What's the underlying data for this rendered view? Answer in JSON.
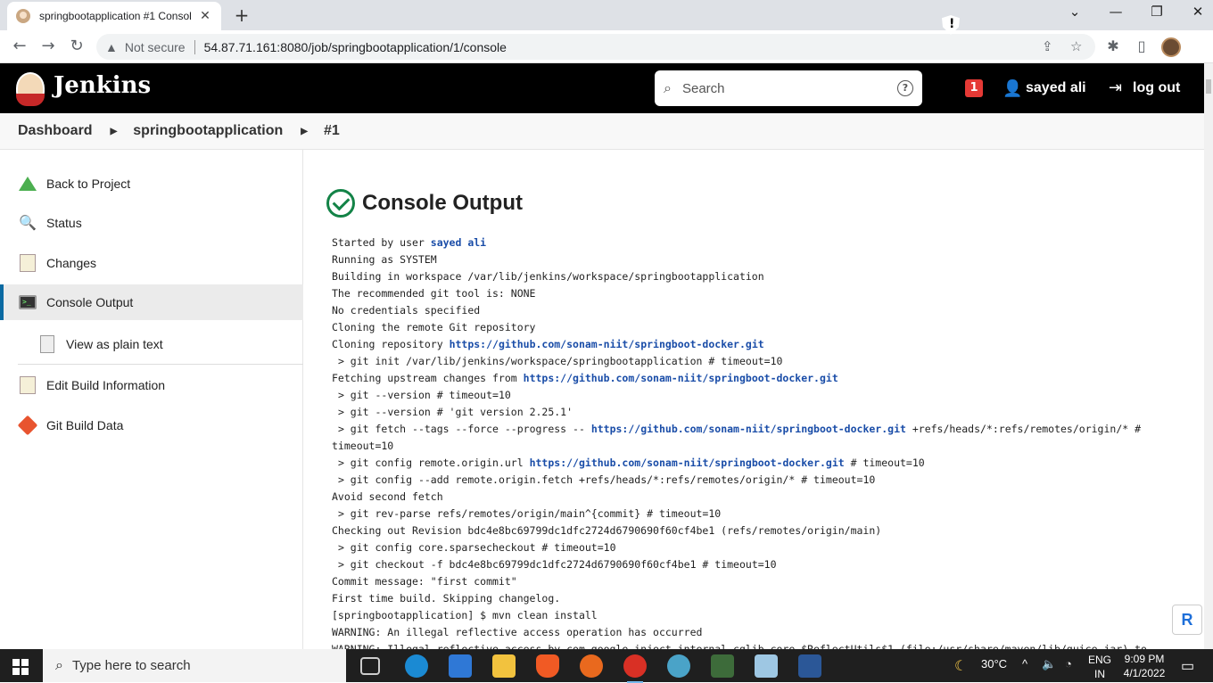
{
  "browser": {
    "tab_title": "springbootapplication #1 Consol",
    "not_secure": "Not secure",
    "url": "54.87.71.161:8080/job/springbootapplication/1/console"
  },
  "header": {
    "app_name": "Jenkins",
    "search_placeholder": "Search",
    "alert_count": "1",
    "user_name": "sayed ali",
    "logout_label": "log out"
  },
  "breadcrumb": {
    "items": [
      "Dashboard",
      "springbootapplication",
      "#1"
    ]
  },
  "sidebar": {
    "items": [
      {
        "label": "Back to Project",
        "icon": "up-arrow-icon"
      },
      {
        "label": "Status",
        "icon": "magnifier-icon"
      },
      {
        "label": "Changes",
        "icon": "notepad-icon"
      },
      {
        "label": "Console Output",
        "icon": "terminal-icon"
      },
      {
        "label": "View as plain text",
        "icon": "document-icon"
      },
      {
        "label": "Edit Build Information",
        "icon": "notepad-icon"
      },
      {
        "label": "Git Build Data",
        "icon": "git-icon"
      }
    ]
  },
  "main": {
    "title": "Console Output",
    "console": [
      {
        "pre": "Started by user ",
        "link": "sayed ali",
        "post": ""
      },
      {
        "pre": "Running as SYSTEM"
      },
      {
        "pre": "Building in workspace /var/lib/jenkins/workspace/springbootapplication"
      },
      {
        "pre": "The recommended git tool is: NONE"
      },
      {
        "pre": "No credentials specified"
      },
      {
        "pre": "Cloning the remote Git repository"
      },
      {
        "pre": "Cloning repository ",
        "link": "https://github.com/sonam-niit/springboot-docker.git",
        "post": ""
      },
      {
        "pre": " > git init /var/lib/jenkins/workspace/springbootapplication # timeout=10"
      },
      {
        "pre": "Fetching upstream changes from ",
        "link": "https://github.com/sonam-niit/springboot-docker.git",
        "post": ""
      },
      {
        "pre": " > git --version # timeout=10"
      },
      {
        "pre": " > git --version # 'git version 2.25.1'"
      },
      {
        "pre": " > git fetch --tags --force --progress -- ",
        "link": "https://github.com/sonam-niit/springboot-docker.git",
        "post": " +refs/heads/*:refs/remotes/origin/* #\ntimeout=10"
      },
      {
        "pre": " > git config remote.origin.url ",
        "link": "https://github.com/sonam-niit/springboot-docker.git",
        "post": " # timeout=10"
      },
      {
        "pre": " > git config --add remote.origin.fetch +refs/heads/*:refs/remotes/origin/* # timeout=10"
      },
      {
        "pre": "Avoid second fetch"
      },
      {
        "pre": " > git rev-parse refs/remotes/origin/main^{commit} # timeout=10"
      },
      {
        "pre": "Checking out Revision bdc4e8bc69799dc1dfc2724d6790690f60cf4be1 (refs/remotes/origin/main)"
      },
      {
        "pre": " > git config core.sparsecheckout # timeout=10"
      },
      {
        "pre": " > git checkout -f bdc4e8bc69799dc1dfc2724d6790690f60cf4be1 # timeout=10"
      },
      {
        "pre": "Commit message: \"first commit\""
      },
      {
        "pre": "First time build. Skipping changelog."
      },
      {
        "pre": "[springbootapplication] $ mvn clean install"
      },
      {
        "pre": "WARNING: An illegal reflective access operation has occurred"
      },
      {
        "pre": "WARNING: Illegal reflective access by com.google.inject.internal.cglib.core.$ReflectUtils$1 (file:/usr/share/maven/lib/guice.jar) to"
      }
    ]
  },
  "taskbar": {
    "search_placeholder": "Type here to search",
    "temperature": "30°C",
    "language": "ENG",
    "region": "IN",
    "time": "9:09 PM",
    "date": "4/1/2022"
  }
}
